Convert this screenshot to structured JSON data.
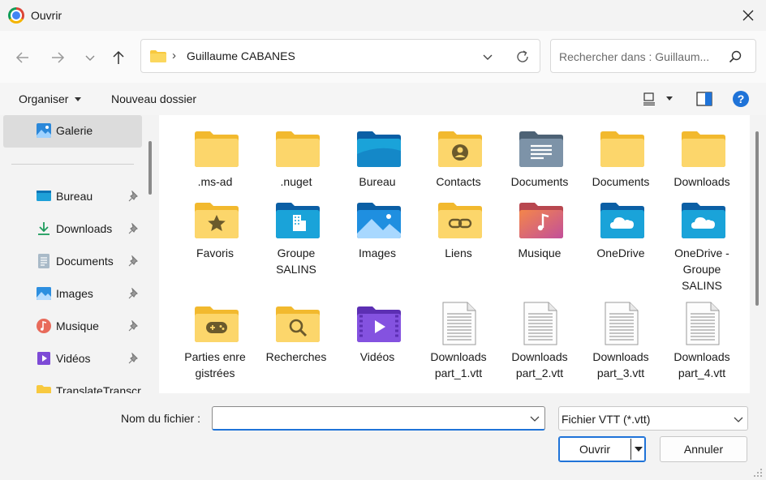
{
  "window": {
    "title": "Ouvrir"
  },
  "address": {
    "separator": "›",
    "path": "Guillaume CABANES"
  },
  "search": {
    "placeholder": "Rechercher dans : Guillaum..."
  },
  "toolbar": {
    "organize": "Organiser",
    "new_folder": "Nouveau dossier",
    "help": "?"
  },
  "sidebar": {
    "gallery": {
      "label": "Galerie",
      "icon": "gallery-icon"
    },
    "items": [
      {
        "label": "Bureau",
        "icon": "desktop-icon",
        "pinned": true
      },
      {
        "label": "Downloads",
        "icon": "download-icon",
        "pinned": true
      },
      {
        "label": "Documents",
        "icon": "document-icon",
        "pinned": true
      },
      {
        "label": "Images",
        "icon": "image-icon",
        "pinned": true
      },
      {
        "label": "Musique",
        "icon": "music-icon",
        "pinned": true
      },
      {
        "label": "Vidéos",
        "icon": "video-icon",
        "pinned": true
      },
      {
        "label": "TranslateTranscr",
        "icon": "folder-icon",
        "pinned": false
      }
    ]
  },
  "files": [
    {
      "label": ".ms-ad",
      "icon": "folder-icon"
    },
    {
      "label": ".nuget",
      "icon": "folder-icon"
    },
    {
      "label": "Bureau",
      "icon": "desktop-folder-icon"
    },
    {
      "label": "Contacts",
      "icon": "contacts-folder-icon"
    },
    {
      "label": "Documents",
      "icon": "documents-folder-icon"
    },
    {
      "label": "Documents",
      "icon": "folder-icon"
    },
    {
      "label": "Downloads",
      "icon": "folder-icon"
    },
    {
      "label": "Favoris",
      "icon": "favorites-folder-icon"
    },
    {
      "label": "Groupe SALINS",
      "icon": "company-folder-icon"
    },
    {
      "label": "Images",
      "icon": "pictures-folder-icon"
    },
    {
      "label": "Liens",
      "icon": "links-folder-icon"
    },
    {
      "label": "Musique",
      "icon": "music-folder-icon"
    },
    {
      "label": "OneDrive",
      "icon": "onedrive-folder-icon"
    },
    {
      "label": "OneDrive - Groupe SALINS",
      "icon": "onedrive-folder-icon"
    },
    {
      "label": "Parties enregistrées",
      "icon": "saved-games-folder-icon"
    },
    {
      "label": "Recherches",
      "icon": "searches-folder-icon"
    },
    {
      "label": "Vidéos",
      "icon": "videos-folder-icon"
    },
    {
      "label": "Downloads part_1.vtt",
      "icon": "text-file-icon"
    },
    {
      "label": "Downloads part_2.vtt",
      "icon": "text-file-icon"
    },
    {
      "label": "Downloads part_3.vtt",
      "icon": "text-file-icon"
    },
    {
      "label": "Downloads part_4.vtt",
      "icon": "text-file-icon"
    }
  ],
  "footer": {
    "filename_label": "Nom du fichier :",
    "filename_value": "",
    "file_type": "Fichier VTT (*.vtt)",
    "open_label": "Ouvrir",
    "cancel_label": "Annuler"
  },
  "colors": {
    "accent": "#1f73d8",
    "folder": "#f8d35e",
    "selection": "#dcdcdc"
  }
}
